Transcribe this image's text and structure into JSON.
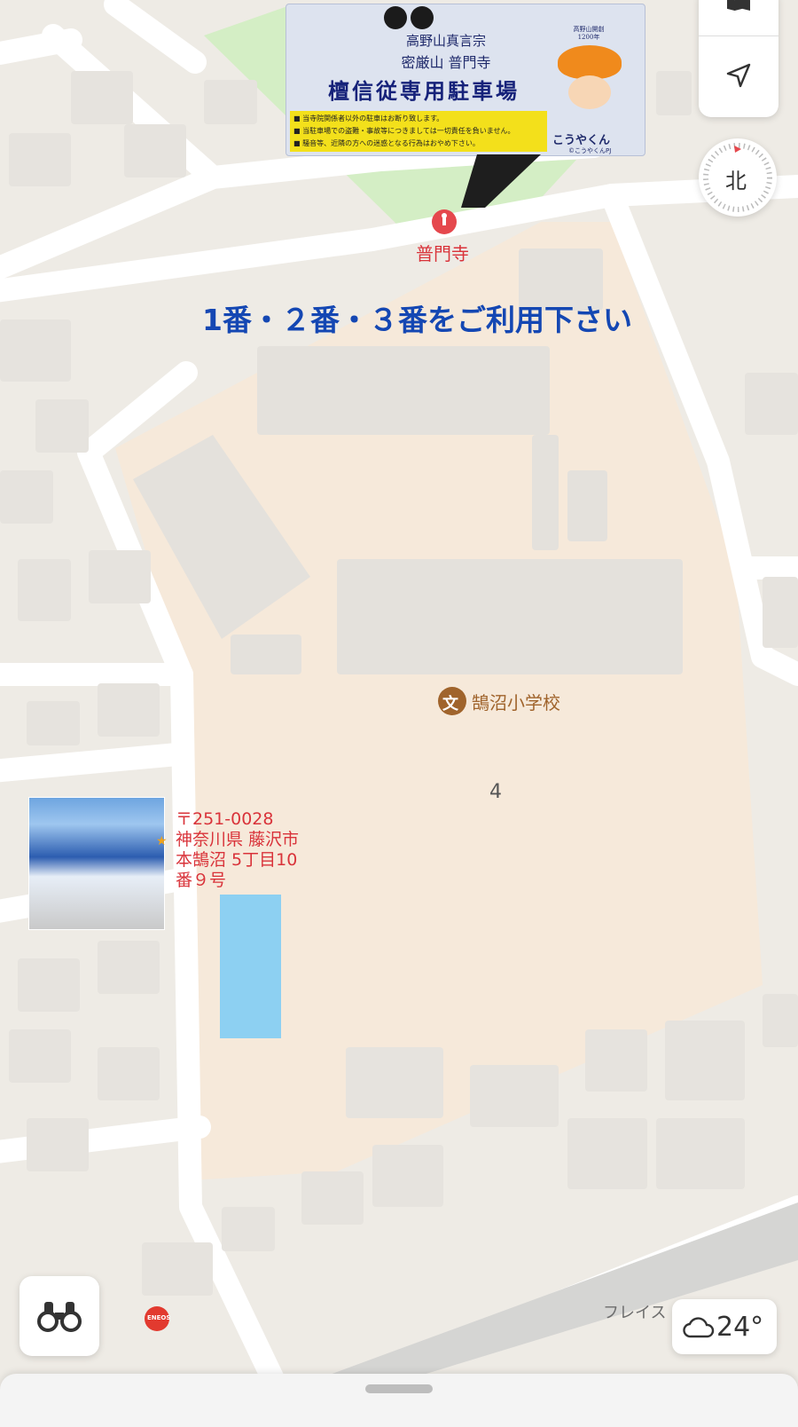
{
  "sign": {
    "line1": "高野山真言宗",
    "line2": "密厳山 普門寺",
    "title": "檀信従専用駐車場",
    "rules": [
      "■ 当寺院関係者以外の駐車はお断り致します。",
      "■ 当駐車場での盗難・事故等につきましては一切責任を負いません。",
      "■ 騒音等、近隣の方への迷惑となる行為はおやめ下さい。"
    ],
    "badge_text": "高野山開創1200年",
    "mascot_name": "こうやくん",
    "mascot_credit": "©こうやくんPJ"
  },
  "pois": {
    "temple": {
      "label": "普門寺",
      "icon": "pin-icon"
    },
    "school": {
      "label": "鵠沼小学校",
      "icon": "school-icon",
      "glyph": "文"
    },
    "gas": {
      "label": "ENEOS"
    },
    "road": {
      "label": "フレイス"
    }
  },
  "banner": "1番・２番・３番をご利用下さい",
  "parking_number": "4",
  "address": {
    "line1": "〒251-0028",
    "line2": "神奈川県 藤沢市",
    "line3": "本鵠沼 5丁目10",
    "line4": "番９号"
  },
  "controls": {
    "compass": "北",
    "weather_temp": "24°",
    "icons": [
      "map-icon",
      "location-arrow-icon",
      "binoculars-icon",
      "cloud-icon"
    ]
  },
  "colors": {
    "banner": "#1447b3",
    "address": "#d9333a",
    "parking_highlight": "#8dd0f2",
    "school_label": "#a0642c"
  }
}
